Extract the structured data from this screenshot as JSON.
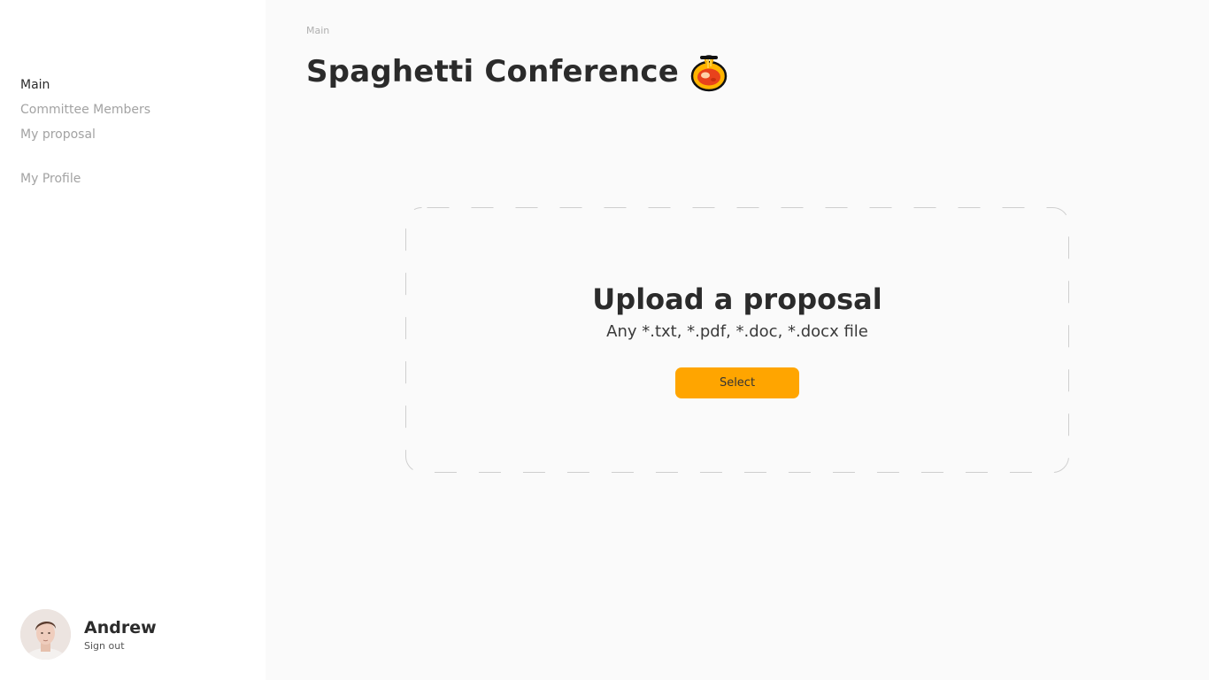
{
  "sidebar": {
    "nav": {
      "main": "Main",
      "committee": "Committee Members",
      "proposal": "My proposal",
      "profile": "My Profile"
    },
    "user": {
      "name": "Andrew",
      "signout": "Sign out"
    }
  },
  "main": {
    "breadcrumb": "Main",
    "title": "Spaghetti Conference",
    "title_icon": "spaghetti-emoji",
    "upload": {
      "title": "Upload a proposal",
      "subtitle": "Any *.txt, *.pdf, *.doc, *.docx file",
      "button": "Select"
    }
  },
  "colors": {
    "accent": "#ffa500",
    "text": "#2b2b2b",
    "muted": "#a3a3a3",
    "sidebar_bg": "#ffffff",
    "main_bg": "#fafafa"
  }
}
